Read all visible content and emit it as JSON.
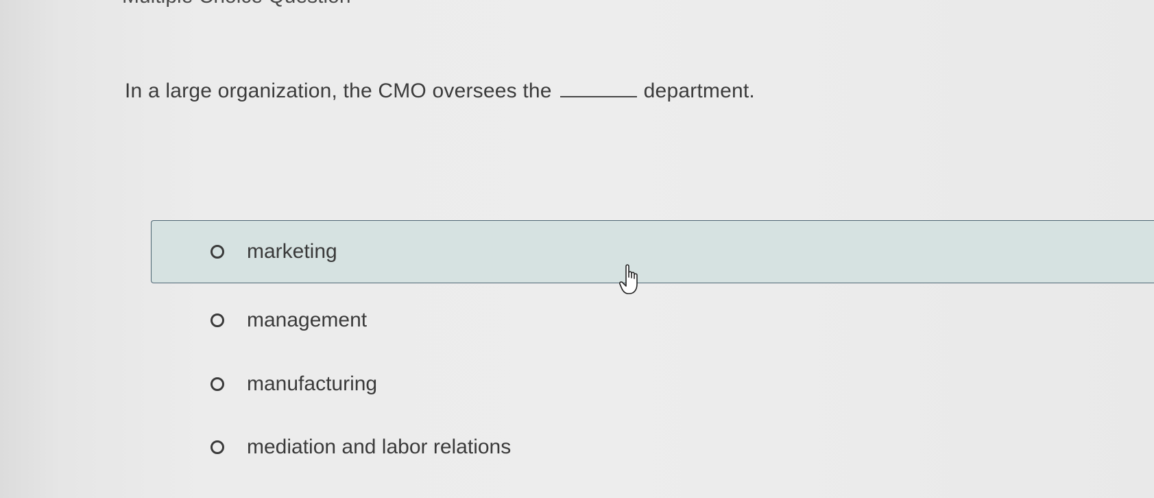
{
  "page": {
    "heading": "Multiple Choice Question"
  },
  "question": {
    "text_before": "In a large organization, the CMO oversees the",
    "text_after": "department."
  },
  "options": [
    {
      "label": "marketing",
      "selected": false,
      "hovered": true
    },
    {
      "label": "management",
      "selected": false,
      "hovered": false
    },
    {
      "label": "manufacturing",
      "selected": false,
      "hovered": false
    },
    {
      "label": "mediation and labor relations",
      "selected": false,
      "hovered": false
    }
  ],
  "colors": {
    "hover_background": "#d6e2e1",
    "hover_border": "#4d6573",
    "text": "#3a3a3a"
  },
  "cursor": {
    "icon": "hand-pointer-icon"
  }
}
